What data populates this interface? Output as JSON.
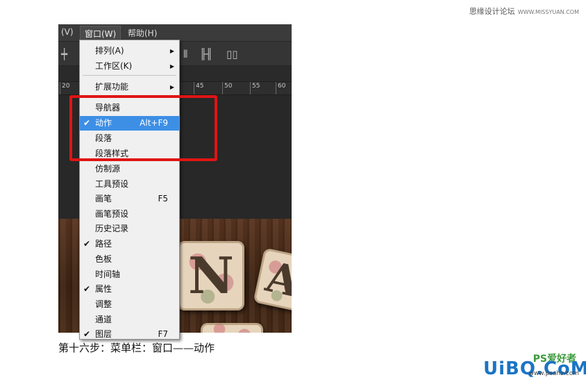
{
  "watermarks": {
    "top_text": "思缘设计论坛",
    "top_url": "WWW.MISSYUAN.COM",
    "bottom_brand": "UiBQ.CoM",
    "bottom_ps": "PS爱好者",
    "bottom_site": "www.psahz.com"
  },
  "menubar": {
    "items": [
      "视图(V)",
      "窗口(W)",
      "帮助(H)"
    ],
    "visible_partial": "(V)",
    "active": "窗口(W)"
  },
  "ruler": {
    "ticks": [
      "20",
      "45",
      "50",
      "55",
      "60"
    ]
  },
  "canvas": {
    "letters": [
      "N",
      "A"
    ]
  },
  "dropdown": {
    "items": [
      {
        "label": "排列(A)",
        "submenu": true
      },
      {
        "label": "工作区(K)",
        "submenu": true
      },
      {
        "label": "扩展功能",
        "submenu": true
      },
      {
        "label": "导航器"
      },
      {
        "label": "动作",
        "checked": true,
        "shortcut": "Alt+F9",
        "highlighted": true
      },
      {
        "label": "段落"
      },
      {
        "label": "段落样式"
      },
      {
        "label": "仿制源"
      },
      {
        "label": "工具预设"
      },
      {
        "label": "画笔",
        "shortcut": "F5"
      },
      {
        "label": "画笔预设"
      },
      {
        "label": "历史记录"
      },
      {
        "label": "路径",
        "checked": true
      },
      {
        "label": "色板"
      },
      {
        "label": "时间轴"
      },
      {
        "label": "属性",
        "checked": true
      },
      {
        "label": "调整"
      },
      {
        "label": "通道"
      },
      {
        "label": "图层",
        "checked": true,
        "shortcut": "F7"
      }
    ],
    "check_glyph": "✔",
    "submenu_glyph": "▶"
  },
  "caption": "第十六步：菜单栏：窗口——动作",
  "colors": {
    "highlight": "#3d8fe6",
    "red_box": "#e01414"
  }
}
